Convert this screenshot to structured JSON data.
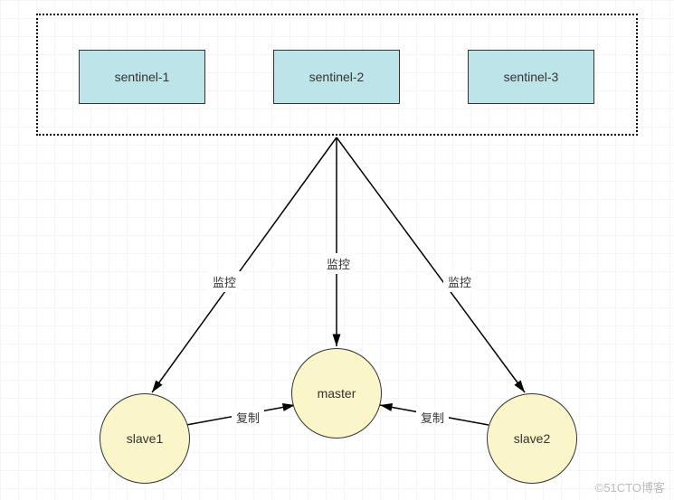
{
  "diagram": {
    "group": {
      "type": "dashed-container"
    },
    "sentinels": [
      {
        "label": "sentinel-1"
      },
      {
        "label": "sentinel-2"
      },
      {
        "label": "sentinel-3"
      }
    ],
    "nodes": {
      "master": {
        "label": "master",
        "shape": "circle",
        "fill": "#faf6c9"
      },
      "slave1": {
        "label": "slave1",
        "shape": "circle",
        "fill": "#faf6c9"
      },
      "slave2": {
        "label": "slave2",
        "shape": "circle",
        "fill": "#faf6c9"
      }
    },
    "edges": {
      "monitor": {
        "label": "监控",
        "from": "sentinel-group",
        "to": [
          "slave1",
          "master",
          "slave2"
        ]
      },
      "replicate_left": {
        "label": "复制",
        "from": "slave1",
        "to": "master"
      },
      "replicate_right": {
        "label": "复制",
        "from": "slave2",
        "to": "master"
      }
    },
    "colors": {
      "sentinel_fill": "#bde4e8",
      "node_fill": "#faf6c9",
      "edge": "#000000"
    }
  },
  "watermark": "©51CTO博客"
}
